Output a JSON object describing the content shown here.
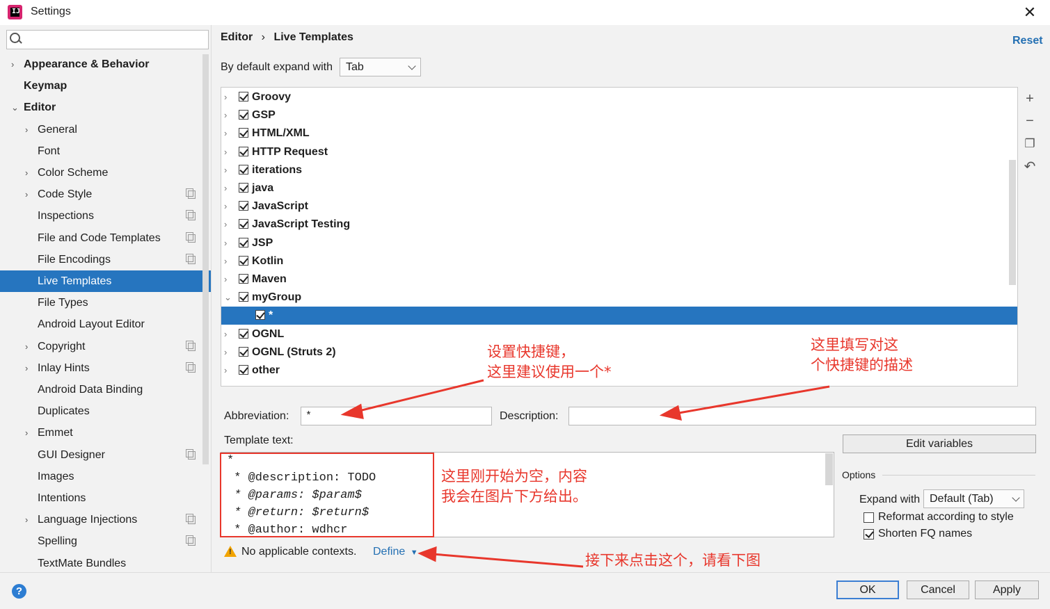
{
  "window": {
    "title": "Settings",
    "close": "✕"
  },
  "search": {
    "placeholder": ""
  },
  "sidebar": {
    "items": [
      {
        "label": "Appearance & Behavior"
      },
      {
        "label": "Keymap"
      },
      {
        "label": "Editor"
      },
      {
        "label": "General"
      },
      {
        "label": "Font"
      },
      {
        "label": "Color Scheme"
      },
      {
        "label": "Code Style"
      },
      {
        "label": "Inspections"
      },
      {
        "label": "File and Code Templates"
      },
      {
        "label": "File Encodings"
      },
      {
        "label": "Live Templates"
      },
      {
        "label": "File Types"
      },
      {
        "label": "Android Layout Editor"
      },
      {
        "label": "Copyright"
      },
      {
        "label": "Inlay Hints"
      },
      {
        "label": "Android Data Binding"
      },
      {
        "label": "Duplicates"
      },
      {
        "label": "Emmet"
      },
      {
        "label": "GUI Designer"
      },
      {
        "label": "Images"
      },
      {
        "label": "Intentions"
      },
      {
        "label": "Language Injections"
      },
      {
        "label": "Spelling"
      },
      {
        "label": "TextMate Bundles"
      }
    ]
  },
  "breadcrumb": {
    "parent": "Editor",
    "sep": "›",
    "current": "Live Templates"
  },
  "reset_label": "Reset",
  "expand": {
    "label": "By default expand with",
    "value": "Tab"
  },
  "tree": {
    "rows": [
      {
        "label": "Groovy"
      },
      {
        "label": "GSP"
      },
      {
        "label": "HTML/XML"
      },
      {
        "label": "HTTP Request"
      },
      {
        "label": "iterations"
      },
      {
        "label": "java"
      },
      {
        "label": "JavaScript"
      },
      {
        "label": "JavaScript Testing"
      },
      {
        "label": "JSP"
      },
      {
        "label": "Kotlin"
      },
      {
        "label": "Maven"
      },
      {
        "label": "myGroup"
      },
      {
        "label": "*"
      },
      {
        "label": "OGNL"
      },
      {
        "label": "OGNL (Struts 2)"
      },
      {
        "label": "other"
      }
    ]
  },
  "tools": {
    "add": "+",
    "remove": "−",
    "copy": "❐",
    "restore": "↶"
  },
  "abbreviation": {
    "label": "Abbreviation:",
    "value": "*"
  },
  "description": {
    "label": "Description:",
    "value": ""
  },
  "template": {
    "label": "Template text:",
    "lines": [
      "*",
      " * @description: TODO",
      " * @params: $param$",
      " * @return: $return$",
      " * @author: wdhcr"
    ]
  },
  "edit_variables": "Edit variables",
  "options": {
    "title": "Options",
    "expand_label": "Expand with",
    "expand_value": "Default (Tab)",
    "reformat_label": "Reformat according to style",
    "reformat_checked": false,
    "shorten_label": "Shorten FQ names",
    "shorten_checked": true
  },
  "contexts": {
    "warning": "No applicable contexts.",
    "define": "Define"
  },
  "buttons": {
    "ok": "OK",
    "cancel": "Cancel",
    "apply": "Apply",
    "help": "?"
  },
  "annotations": {
    "abbr_note": "设置快捷键，\n这里建议使用一个*",
    "desc_note": "这里填写对这\n个快捷键的描述",
    "template_note": "这里刚开始为空，内容\n我会在图片下方给出。",
    "define_note": "接下来点击这个，请看下图"
  },
  "colors": {
    "selection": "#2675bf",
    "link": "#2470b3",
    "annotation": "#e8372c"
  }
}
